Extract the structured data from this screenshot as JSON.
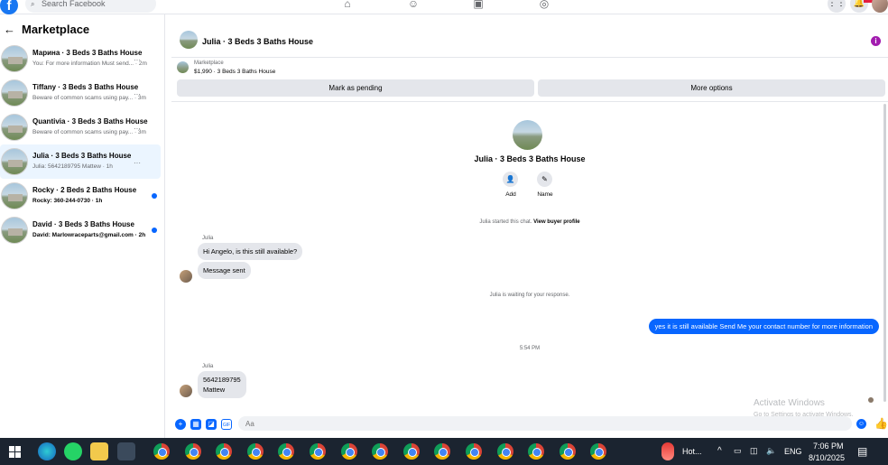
{
  "topbar": {
    "search_placeholder": "Search Facebook",
    "logo": "f"
  },
  "left": {
    "title": "Marketplace",
    "conversations": [
      {
        "name": "Марина · 3 Beds 3 Baths House",
        "snippet": "You: For more information Must send... · 2m",
        "unread": false,
        "active": false,
        "bold": false
      },
      {
        "name": "Tiffany · 3 Beds 3 Baths House",
        "snippet": "Beware of common scams using pay... · 3m",
        "unread": false,
        "active": false,
        "bold": false
      },
      {
        "name": "Quantivia · 3 Beds 3 Baths House",
        "snippet": "Beware of common scams using pay... · 3m",
        "unread": false,
        "active": false,
        "bold": false
      },
      {
        "name": "Julia · 3 Beds 3 Baths House",
        "snippet": "Julia: 5642189795 Mattew · 1h",
        "unread": false,
        "active": true,
        "bold": false
      },
      {
        "name": "Rocky · 2 Beds 2 Baths House",
        "snippet": "Rocky: 360-244-0730 · 1h",
        "unread": true,
        "active": false,
        "bold": true
      },
      {
        "name": "David · 3 Beds 3 Baths House",
        "snippet": "David: Marlowraceparts@gmail.com · 2h",
        "unread": true,
        "active": false,
        "bold": true
      }
    ]
  },
  "chat": {
    "header_title": "Julia · 3 Beds 3 Baths House",
    "listing_source": "Marketplace",
    "listing_price": "$1,990 · 3 Beds 3 Baths House",
    "mark_pending": "Mark as pending",
    "more_options": "More options",
    "profile_name": "Julia · 3 Beds 3 Baths House",
    "add_label": "Add",
    "name_label": "Name",
    "started_text": "Julia started this chat.",
    "view_buyer": "View buyer profile",
    "sender1": "Julia",
    "msg1": "Hi Angelo, is this still available?",
    "msg2": "Message sent",
    "waiting": "Julia is waiting for your response.",
    "outgoing": "yes it is still available Send Me your contact number for more information",
    "time": "5:54 PM",
    "sender2": "Julia",
    "msg3_line1": "5642189795",
    "msg3_line2": "Mattew",
    "composer_placeholder": "Aa",
    "watermark_title": "Activate Windows",
    "watermark_sub": "Go to Settings to activate Windows."
  },
  "taskbar": {
    "weather": "Hot...",
    "lang": "ENG",
    "time": "7:06 PM",
    "date": "8/10/2025"
  },
  "colors": {
    "accent": "#0866ff",
    "info": "#a21caf",
    "taskbar": "#1b2430"
  }
}
